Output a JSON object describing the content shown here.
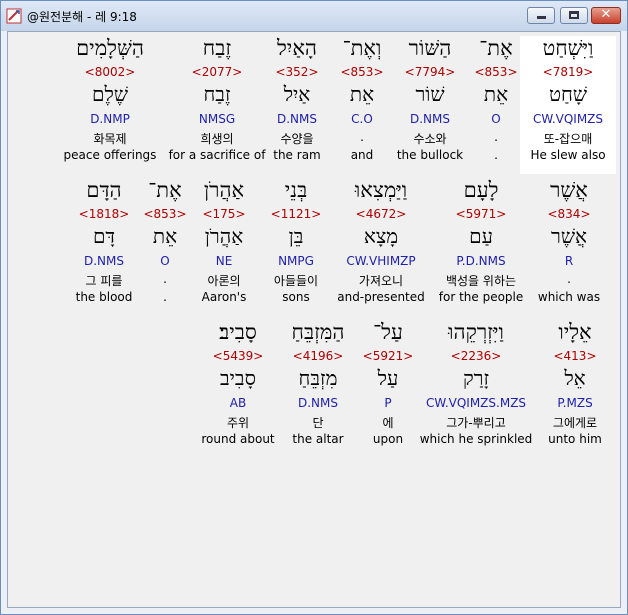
{
  "window": {
    "title": "@원전분해 - 레 9:18"
  },
  "lines": [
    {
      "words": [
        {
          "heb": "וַיִּשְׁחַט",
          "num": "<7819>",
          "lemma": "שָׁחַט",
          "pars": "CW.VQIMZS",
          "kor": "또-잡으매",
          "eng": "He slew also"
        },
        {
          "heb": "אֶת־",
          "num": "<853>",
          "lemma": "אֵת",
          "pars": "O",
          "kor": ".",
          "eng": "."
        },
        {
          "heb": "הַשּׁוֹר",
          "num": "<7794>",
          "lemma": "שׁוֹר",
          "pars": "D.NMS",
          "kor": "수소와",
          "eng": "the bullock"
        },
        {
          "heb": "וְאֶת־",
          "num": "<853>",
          "lemma": "אֵת",
          "pars": "C.O",
          "kor": ".",
          "eng": "and"
        },
        {
          "heb": "הָאַיִל",
          "num": "<352>",
          "lemma": "אַיִל",
          "pars": "D.NMS",
          "kor": "수양을",
          "eng": "the ram"
        },
        {
          "heb": "זֶבַח",
          "num": "<2077>",
          "lemma": "זֶבַח",
          "pars": "NMSG",
          "kor": "희생의",
          "eng": "for a sacrifice of"
        },
        {
          "heb": "הַשְּׁלָמִים",
          "num": "<8002>",
          "lemma": "שֶׁלֶם",
          "pars": "D.NMP",
          "kor": "화목제",
          "eng": "peace offerings"
        }
      ]
    },
    {
      "words": [
        {
          "heb": "אֲשֶׁר",
          "num": "<834>",
          "lemma": "אֲשֶׁר",
          "pars": "R",
          "kor": ".",
          "eng": "which was"
        },
        {
          "heb": "לָעָם",
          "num": "<5971>",
          "lemma": "עַם",
          "pars": "P.D.NMS",
          "kor": "백성을 위하는",
          "eng": "for the people"
        },
        {
          "heb": "וַיַּמְצִאוּ",
          "num": "<4672>",
          "lemma": "מָצָא",
          "pars": "CW.VHIMZP",
          "kor": "가져오니",
          "eng": "and-presented"
        },
        {
          "heb": "בְּנֵי",
          "num": "<1121>",
          "lemma": "בֵּן",
          "pars": "NMPG",
          "kor": "아들들이",
          "eng": "sons"
        },
        {
          "heb": "אַהֲרֹן",
          "num": "<175>",
          "lemma": "אַהֲרֹן",
          "pars": "NE",
          "kor": "아론의",
          "eng": "Aaron's"
        },
        {
          "heb": "אֶת־",
          "num": "<853>",
          "lemma": "אֵת",
          "pars": "O",
          "kor": ".",
          "eng": "."
        },
        {
          "heb": "הַדָּם",
          "num": "<1818>",
          "lemma": "דָּם",
          "pars": "D.NMS",
          "kor": "그 피를",
          "eng": "the blood"
        }
      ]
    },
    {
      "words": [
        {
          "heb": "אֵלָיו",
          "num": "<413>",
          "lemma": "אֵל",
          "pars": "P.MZS",
          "kor": "그에게로",
          "eng": "unto him"
        },
        {
          "heb": "וַיִּזְרְקֵהוּ",
          "num": "<2236>",
          "lemma": "זָרַק",
          "pars": "CW.VQIMZS.MZS",
          "kor": "그가-뿌리고",
          "eng": "which he sprinkled"
        },
        {
          "heb": "עַל־",
          "num": "<5921>",
          "lemma": "עַל",
          "pars": "P",
          "kor": "에",
          "eng": "upon"
        },
        {
          "heb": "הַמִּזְבֵּחַ",
          "num": "<4196>",
          "lemma": "מִזְבֵּחַ",
          "pars": "D.NMS",
          "kor": "단",
          "eng": "the altar"
        },
        {
          "heb": "סָבִיב׃",
          "num": "<5439>",
          "lemma": "סָבִיב",
          "pars": "AB",
          "kor": "주위",
          "eng": "round about"
        }
      ]
    }
  ]
}
